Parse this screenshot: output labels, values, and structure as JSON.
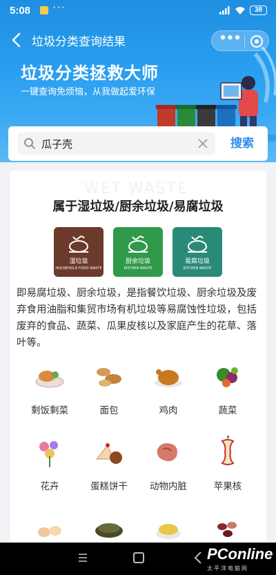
{
  "status": {
    "time": "5:08",
    "dots": "···",
    "battery": "38"
  },
  "nav": {
    "title": "垃圾分类查询结果",
    "more": "•••"
  },
  "banner": {
    "title": "垃圾分类拯救大师",
    "subtitle": "一键查询免烦恼，从我做起爱环保"
  },
  "search": {
    "value": "瓜子壳",
    "button": "搜索"
  },
  "result": {
    "watermark": "WET WASTE",
    "heading": "属于湿垃圾/厨余垃圾/易腐垃圾",
    "badges": [
      {
        "name": "湿垃圾",
        "en": "HOUSEHOLD FOOD WASTE",
        "color": "#6b3a2a"
      },
      {
        "name": "厨余垃圾",
        "en": "KITCHEN WASTE",
        "color": "#2f9a4a"
      },
      {
        "name": "易腐垃圾",
        "en": "KITCHEN WASTE",
        "color": "#2a8a78"
      }
    ],
    "description": "即易腐垃圾、厨余垃圾，是指餐饮垃圾、厨余垃圾及废弃食用油脂和集贸市场有机垃圾等易腐蚀性垃圾，包括废弃的食品、蔬菜、瓜果皮核以及家庭产生的花草、落叶等。",
    "items": [
      {
        "label": "剩饭剩菜",
        "icon": "leftovers-icon"
      },
      {
        "label": "面包",
        "icon": "bread-icon"
      },
      {
        "label": "鸡肉",
        "icon": "chicken-icon"
      },
      {
        "label": "蔬菜",
        "icon": "vegetables-icon"
      },
      {
        "label": "花卉",
        "icon": "flowers-icon"
      },
      {
        "label": "蛋糕饼干",
        "icon": "cake-icon"
      },
      {
        "label": "动物内脏",
        "icon": "offal-icon"
      },
      {
        "label": "苹果核",
        "icon": "apple-core-icon"
      },
      {
        "label": "",
        "icon": "eggshell-icon"
      },
      {
        "label": "",
        "icon": "tea-leaves-icon"
      },
      {
        "label": "",
        "icon": "grains-icon"
      },
      {
        "label": "",
        "icon": "beans-icon"
      }
    ]
  },
  "watermark_logo": {
    "brand": "PConline",
    "sub": "太平洋电脑网"
  },
  "colors": {
    "header": "#2b9ff0",
    "accent": "#2d8fe8"
  }
}
